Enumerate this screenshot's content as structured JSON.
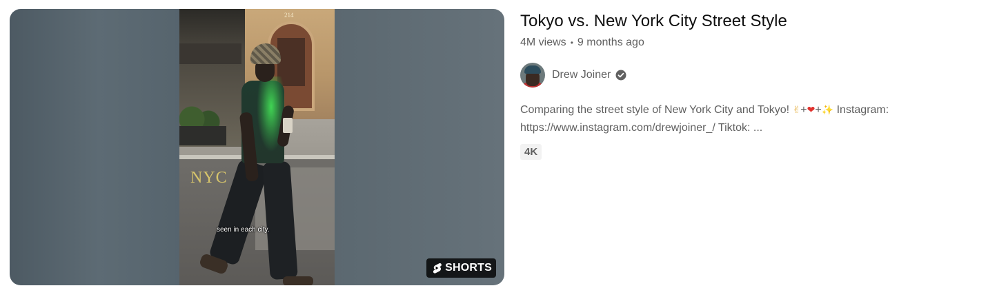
{
  "video": {
    "title": "Tokyo vs. New York City Street Style",
    "views": "4M views",
    "separator": "•",
    "age": "9 months ago",
    "channel_name": "Drew Joiner",
    "description_part1": "Comparing the street style of New York City and Tokyo! ",
    "emoji_peace": "✌",
    "plus1": "+",
    "emoji_heart": "❤",
    "plus2": "+",
    "emoji_sparkles": "✨",
    "description_part2": " Instagram: https://www.instagram.com/drewjoiner_/ Tiktok: ...",
    "badge": "4K"
  },
  "thumbnail": {
    "building_number": "214",
    "overlay_city": "NYC",
    "caption": "seen in each city.",
    "shorts_label": "SHORTS"
  },
  "colors": {
    "title": "#0f0f0f",
    "secondary_text": "#606060",
    "badge_bg": "#f2f2f2",
    "shorts_badge_bg": "#000000cc"
  },
  "icons": {
    "shorts": "shorts-logo-icon",
    "verified": "verified-check-icon"
  }
}
